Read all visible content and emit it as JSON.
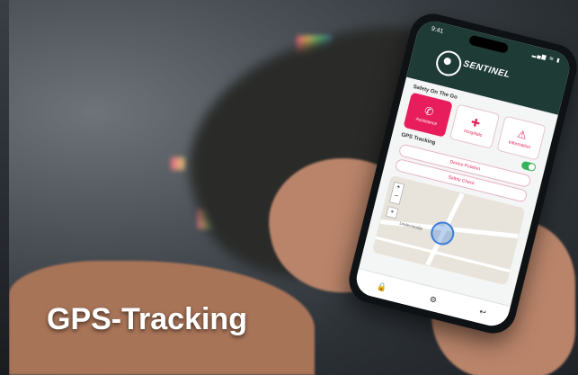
{
  "caption": "GPS-Tracking",
  "app": {
    "time": "9:41",
    "status_icons": "▂▄▆ ≋ ▮",
    "brand": "SENTINEL",
    "brand_color": "#1f3b36",
    "accent_color": "#e81e5c",
    "section_title": "Safety On The Go",
    "tiles": [
      {
        "label": "Assistance",
        "icon": "phone-icon",
        "glyph": "✆"
      },
      {
        "label": "Hospitals",
        "icon": "cross-icon",
        "glyph": "✚"
      },
      {
        "label": "Information",
        "icon": "warning-icon",
        "glyph": "⚠"
      }
    ],
    "gps_label": "GPS Tracking",
    "gps_enabled": true,
    "buttons": [
      "Device Position",
      "Safety Check"
    ],
    "map": {
      "place_label": "Lindenstraße",
      "zoom_in": "+",
      "zoom_out": "−",
      "locate_glyph": "⌖"
    },
    "nav": [
      {
        "icon": "lock-icon",
        "glyph": "🔒"
      },
      {
        "icon": "gear-icon",
        "glyph": "⚙"
      },
      {
        "icon": "back-icon",
        "glyph": "↩"
      }
    ]
  }
}
